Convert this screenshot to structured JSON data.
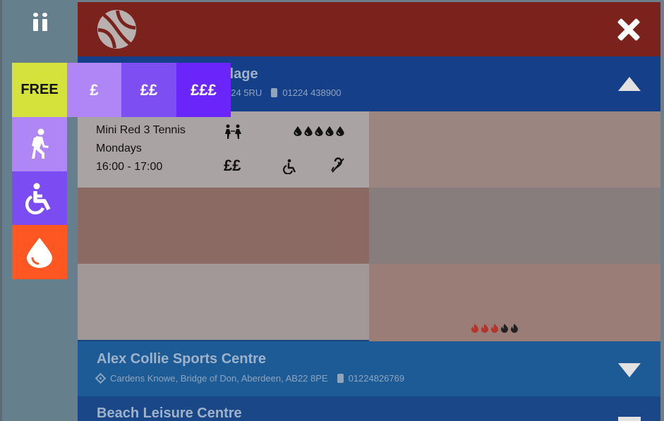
{
  "rail": {
    "pause_icon": "pause-icon"
  },
  "topbar": {
    "logo_icon": "tennis-ball-icon",
    "close_icon": "close-icon",
    "color": "#7c221d"
  },
  "venues": [
    {
      "name_partial": "llage",
      "address_partial": "324 5RU",
      "phone": "01224 438900",
      "expanded": true
    },
    {
      "name": "Alex Collie Sports Centre",
      "address": "Cardens Knowe, Bridge of Don, Aberdeen, AB22 8PE",
      "phone": "01224826769",
      "expanded": false
    },
    {
      "name": "Beach Leisure Centre",
      "expanded": false
    }
  ],
  "session": {
    "title": "Mini Red 3 Tennis",
    "day": "Mondays",
    "time": "16:00 - 17:00",
    "price": "££",
    "icons": [
      "family-icon",
      "drop-intensity-icon",
      "wheelchair-icon",
      "hearing-loop-icon"
    ],
    "intensity_drops": 5
  },
  "flame_rating": {
    "active": 3,
    "total": 5,
    "active_color": "#b5332a",
    "inactive_color": "#222222"
  },
  "filters": {
    "price": [
      {
        "label": "FREE",
        "color": "#d4e23b"
      },
      {
        "label": "£",
        "color": "#b085f5"
      },
      {
        "label": "££",
        "color": "#7d4ef1"
      },
      {
        "label": "£££",
        "color": "#6a25fb"
      }
    ],
    "other": [
      {
        "icon": "walking-icon",
        "color": "#b085f5"
      },
      {
        "icon": "wheelchair-icon",
        "color": "#7a4cf1"
      },
      {
        "icon": "drop-icon",
        "color": "#fe5722"
      }
    ]
  }
}
